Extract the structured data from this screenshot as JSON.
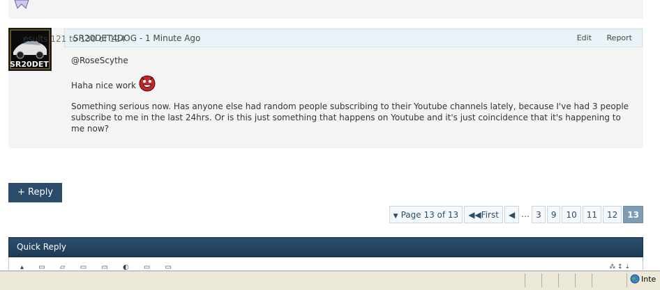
{
  "post": {
    "ghost_text": "esults 121 to 130 of 124",
    "author": "SR20DET4DOG",
    "time": " - 1 Minute Ago",
    "avatar_text": "SR20DET",
    "actions": {
      "edit": "Edit",
      "report": "Report"
    },
    "body": {
      "mention": "@RoseScythe",
      "line1": "Haha nice work",
      "paragraph": "Something serious now. Has anyone else had random people subscribing to their Youtube channels lately, because I've had 3 people subscribe to me in the last 24hrs. Or is this just something that happens on Youtube and it's just coincidence that it's happening to me now?"
    }
  },
  "reply_button": "+ Reply",
  "pagination": {
    "summary": "Page 13 of 13",
    "first": "First",
    "ellipsis": "…",
    "pages": [
      "3",
      "9",
      "10",
      "11",
      "12"
    ],
    "current": "13"
  },
  "quick_reply": {
    "title": "Quick Reply"
  },
  "statusbar": {
    "zone": "Inte"
  }
}
